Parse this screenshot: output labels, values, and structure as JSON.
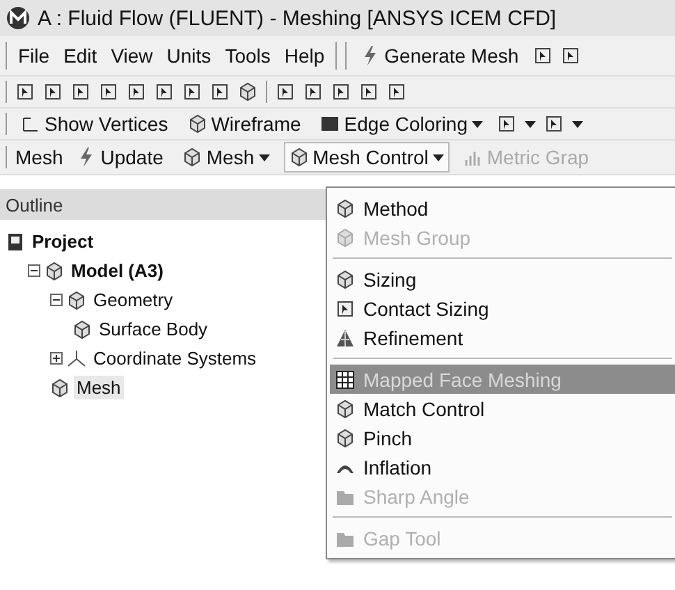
{
  "window": {
    "title": "A : Fluid Flow (FLUENT) - Meshing [ANSYS ICEM CFD]"
  },
  "menu_bar": {
    "items": [
      "File",
      "Edit",
      "View",
      "Units",
      "Tools",
      "Help"
    ],
    "generate_button": "Generate Mesh"
  },
  "display_toolbar": [
    {
      "label": "Show Vertices",
      "dropdown": false
    },
    {
      "label": "Wireframe",
      "dropdown": false
    },
    {
      "label": "Edge Coloring",
      "dropdown": true
    }
  ],
  "mesh_toolbar": {
    "title": "Mesh",
    "buttons": [
      {
        "label": "Update",
        "dropdown": false,
        "selected": false,
        "disabled": false
      },
      {
        "label": "Mesh",
        "dropdown": true,
        "selected": false,
        "disabled": false
      },
      {
        "label": "Mesh Control",
        "dropdown": true,
        "selected": true,
        "disabled": false
      },
      {
        "label": "Metric Grap",
        "dropdown": false,
        "selected": false,
        "disabled": true
      }
    ]
  },
  "outline": {
    "title": "Outline",
    "tree": [
      {
        "label": "Project",
        "bold": true,
        "children": [
          {
            "label": "Model (A3)",
            "bold": true,
            "expanded": true,
            "children": [
              {
                "label": "Geometry",
                "bold": false,
                "expanded": true,
                "children": [
                  {
                    "label": "Surface Body",
                    "bold": false,
                    "selected": false
                  }
                ],
                "selected": false
              },
              {
                "label": "Coordinate Systems",
                "bold": false,
                "expanded": false,
                "selected": false
              },
              {
                "label": "Mesh",
                "bold": false,
                "selected": true
              }
            ],
            "selected": false
          }
        ],
        "selected": false
      }
    ]
  },
  "dropdown_menu": {
    "items": [
      {
        "kind": "item",
        "label": "Method",
        "disabled": false,
        "selected": false
      },
      {
        "kind": "item",
        "label": "Mesh Group",
        "disabled": true,
        "selected": false
      },
      {
        "kind": "separator"
      },
      {
        "kind": "item",
        "label": "Sizing",
        "disabled": false,
        "selected": false
      },
      {
        "kind": "item",
        "label": "Contact Sizing",
        "disabled": false,
        "selected": false
      },
      {
        "kind": "item",
        "label": "Refinement",
        "disabled": false,
        "selected": false
      },
      {
        "kind": "separator"
      },
      {
        "kind": "item",
        "label": "Mapped Face Meshing",
        "disabled": false,
        "selected": true
      },
      {
        "kind": "item",
        "label": "Match Control",
        "disabled": false,
        "selected": false
      },
      {
        "kind": "item",
        "label": "Pinch",
        "disabled": false,
        "selected": false
      },
      {
        "kind": "item",
        "label": "Inflation",
        "disabled": false,
        "selected": false
      },
      {
        "kind": "item",
        "label": "Sharp Angle",
        "disabled": true,
        "selected": false
      },
      {
        "kind": "separator"
      },
      {
        "kind": "item",
        "label": "Gap Tool",
        "disabled": true,
        "selected": false
      }
    ]
  }
}
